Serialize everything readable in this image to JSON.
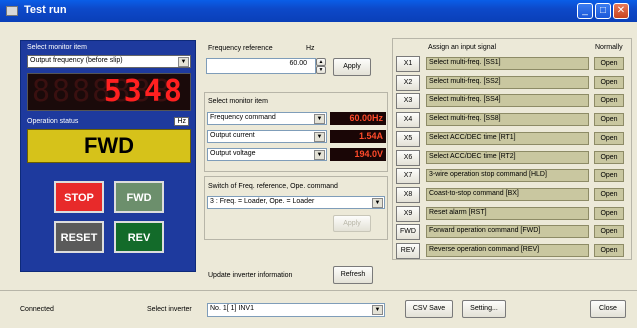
{
  "window": {
    "title": "Test run"
  },
  "monitor": {
    "select_label": "Select monitor item",
    "select_value": "Output frequency (before slip)",
    "led_value": "5348",
    "status_label": "Operation status",
    "hz_label": "Hz",
    "status_value": "FWD"
  },
  "controls": {
    "stop": "STOP",
    "fwd": "FWD",
    "reset": "RESET",
    "rev": "REV"
  },
  "frequency": {
    "label": "Frequency reference",
    "unit": "Hz",
    "value": "60.00",
    "apply": "Apply"
  },
  "monitor_items": {
    "label": "Select monitor item",
    "rows": [
      {
        "item": "Frequency command",
        "value": "60.00Hz"
      },
      {
        "item": "Output current",
        "value": "1.54A"
      },
      {
        "item": "Output voltage",
        "value": "194.0V"
      }
    ]
  },
  "switch": {
    "label": "Switch of Freq. reference, Ope. command",
    "value": "3 : Freq. = Loader,  Ope. = Loader",
    "apply": "Apply"
  },
  "update": {
    "label": "Update inverter information",
    "refresh": "Refresh"
  },
  "signals": {
    "header": "Assign an input signal",
    "normally": "Normally",
    "rows": [
      {
        "key": "X1",
        "signal": "Select multi-freq. [SS1]",
        "state": "Open"
      },
      {
        "key": "X2",
        "signal": "Select multi-freq. [SS2]",
        "state": "Open"
      },
      {
        "key": "X3",
        "signal": "Select multi-freq. [SS4]",
        "state": "Open"
      },
      {
        "key": "X4",
        "signal": "Select multi-freq. [SS8]",
        "state": "Open"
      },
      {
        "key": "X5",
        "signal": "Select ACC/DEC time [RT1]",
        "state": "Open"
      },
      {
        "key": "X6",
        "signal": "Select ACC/DEC time [RT2]",
        "state": "Open"
      },
      {
        "key": "X7",
        "signal": "3-wire operation stop command [HLD]",
        "state": "Open"
      },
      {
        "key": "X8",
        "signal": "Coast-to-stop command [BX]",
        "state": "Open"
      },
      {
        "key": "X9",
        "signal": "Reset alarm [RST]",
        "state": "Open"
      },
      {
        "key": "FWD",
        "signal": "Forward operation command [FWD]",
        "state": "Open"
      },
      {
        "key": "REV",
        "signal": "Reverse operation command [REV]",
        "state": "Open"
      }
    ]
  },
  "footer": {
    "status": "Connected",
    "inverter_label": "Select inverter",
    "inverter_value": "No. 1[  1] INV1",
    "csv_save": "CSV Save",
    "setting": "Setting...",
    "close": "Close"
  }
}
